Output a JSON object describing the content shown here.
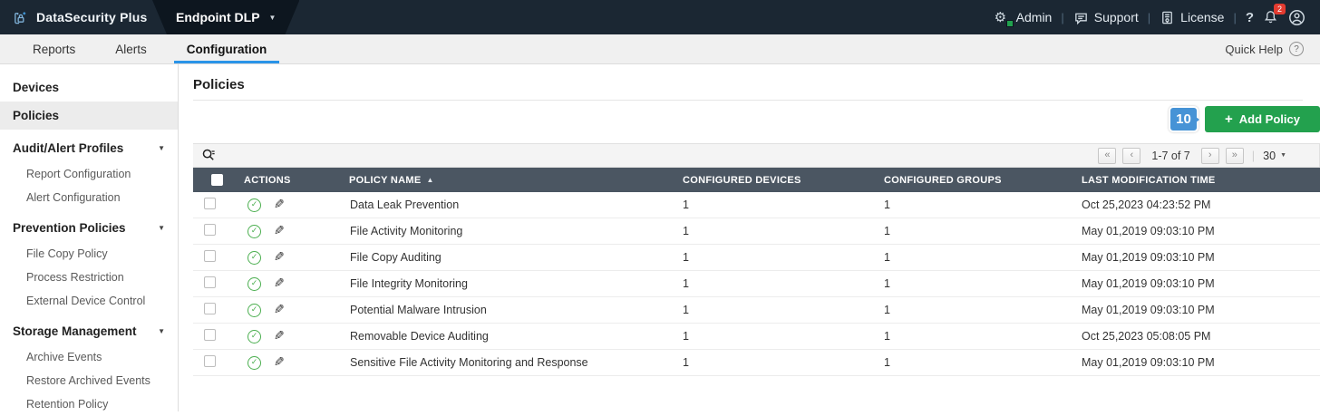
{
  "topbar": {
    "brand": "DataSecurity Plus",
    "product": "Endpoint DLP",
    "admin_label": "Admin",
    "support_label": "Support",
    "license_label": "License",
    "notification_count": "2"
  },
  "tabs": {
    "reports": "Reports",
    "alerts": "Alerts",
    "configuration": "Configuration",
    "quick_help": "Quick Help"
  },
  "sidebar": {
    "items": [
      {
        "label": "Devices"
      },
      {
        "label": "Policies"
      },
      {
        "label": "Audit/Alert Profiles"
      },
      {
        "label": "Report Configuration"
      },
      {
        "label": "Alert Configuration"
      },
      {
        "label": "Prevention Policies"
      },
      {
        "label": "File Copy Policy"
      },
      {
        "label": "Process Restriction"
      },
      {
        "label": "External Device Control"
      },
      {
        "label": "Storage Management"
      },
      {
        "label": "Archive Events"
      },
      {
        "label": "Restore Archived Events"
      },
      {
        "label": "Retention Policy"
      }
    ]
  },
  "main": {
    "title": "Policies",
    "annotation_badge": "10",
    "add_policy_label": "Add Policy",
    "pagination": {
      "range": "1-7 of 7",
      "page_size": "30"
    },
    "table": {
      "headers": {
        "actions": "ACTIONS",
        "policy_name": "POLICY NAME",
        "devices": "CONFIGURED DEVICES",
        "groups": "CONFIGURED GROUPS",
        "last_modified": "LAST MODIFICATION TIME"
      },
      "rows": [
        {
          "name": "Data Leak Prevention",
          "devices": "1",
          "groups": "1",
          "time": "Oct 25,2023 04:23:52 PM"
        },
        {
          "name": "File Activity Monitoring",
          "devices": "1",
          "groups": "1",
          "time": "May 01,2019 09:03:10 PM"
        },
        {
          "name": "File Copy Auditing",
          "devices": "1",
          "groups": "1",
          "time": "May 01,2019 09:03:10 PM"
        },
        {
          "name": "File Integrity Monitoring",
          "devices": "1",
          "groups": "1",
          "time": "May 01,2019 09:03:10 PM"
        },
        {
          "name": "Potential Malware Intrusion",
          "devices": "1",
          "groups": "1",
          "time": "May 01,2019 09:03:10 PM"
        },
        {
          "name": "Removable Device Auditing",
          "devices": "1",
          "groups": "1",
          "time": "Oct 25,2023 05:08:05 PM"
        },
        {
          "name": "Sensitive File Activity Monitoring and Response",
          "devices": "1",
          "groups": "1",
          "time": "May 01,2019 09:03:10 PM"
        }
      ]
    }
  },
  "icons": {
    "plus": "+",
    "caret_down": "▼",
    "sort_asc": "▲",
    "check": "✓",
    "pencil": "✎",
    "first": "«",
    "prev": "‹",
    "next": "›",
    "last": "»",
    "help": "?",
    "separator": "|"
  },
  "colors": {
    "topbar_bg": "#1b2733",
    "product_chip_bg": "#0d161f",
    "tab_underline_blue": "#2a94e8",
    "accent_green": "#23a14e",
    "annotation_blue": "#4693d6",
    "table_header_slate": "#4b5662",
    "status_green": "#4caf50",
    "alert_red": "#e33b30"
  }
}
